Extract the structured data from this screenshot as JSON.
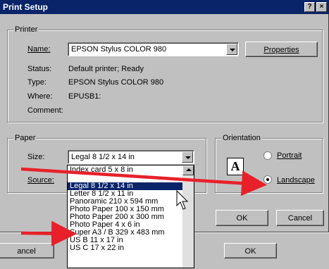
{
  "dialog": {
    "title": "Print Setup",
    "help_button": "?",
    "close_button": "×"
  },
  "printer": {
    "group_label": "Printer",
    "name_label": "Name:",
    "name_value": "EPSON Stylus COLOR 980",
    "properties_button": "Properties",
    "status_label": "Status:",
    "status_value": "Default printer; Ready",
    "type_label": "Type:",
    "type_value": "EPSON Stylus COLOR 980",
    "where_label": "Where:",
    "where_value": "EPUSB1:",
    "comment_label": "Comment:"
  },
  "paper": {
    "group_label": "Paper",
    "size_label": "Size:",
    "size_value": "Legal 8 1/2 x 14 in",
    "source_label": "Source:",
    "size_options": [
      "Index card 5 x 8 in",
      "",
      "Legal 8 1/2 x 14 in",
      "Letter 8 1/2 x 11 in",
      "Panoramic 210 x 594 mm",
      "Photo Paper 100 x 150 mm",
      "Photo Paper 200 x 300 mm",
      "Photo Paper 4 x 6 in",
      "Super A3 / B 329 x 483 mm",
      "US B 11 x 17 in",
      "US C 17 x 22 in"
    ]
  },
  "orientation": {
    "group_label": "Orientation",
    "portrait_label": "Portrait",
    "landscape_label": "Landscape",
    "selected": "Landscape"
  },
  "buttons": {
    "ok": "OK",
    "cancel": "Cancel"
  },
  "background_window": {
    "cancel": "ancel",
    "ok": "OK"
  },
  "colors": {
    "arrow": "#e8202a",
    "titlebar": "#0a246a",
    "face": "#c0c0c0"
  }
}
